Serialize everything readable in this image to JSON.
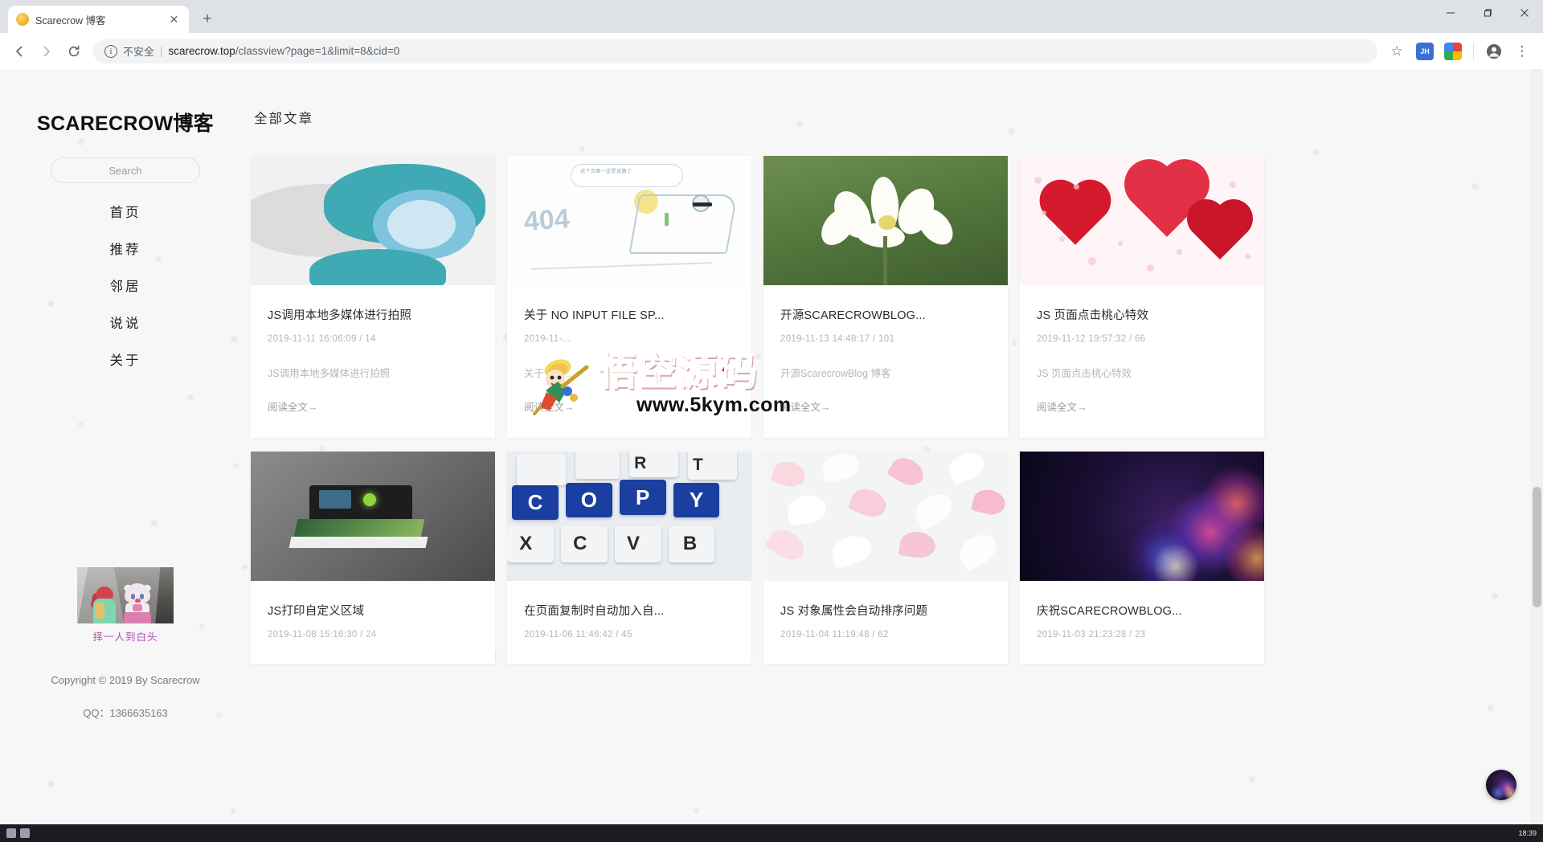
{
  "browser": {
    "tab": {
      "title": "Scarecrow 博客",
      "favicon": "cookie-icon",
      "close": "✕"
    },
    "new_tab": "+",
    "window_controls": {
      "minimize": "minimize-icon",
      "maximize": "maximize-icon",
      "close": "close-icon"
    },
    "nav": {
      "back": "←",
      "forward": "→",
      "reload": "⟳"
    },
    "omnibox": {
      "info_icon": "i",
      "security_label": "不安全",
      "separator": "|",
      "url_host": "scarecrow.top",
      "url_path": "/classview?page=1&limit=8&cid=0"
    },
    "toolbar_right": {
      "bookmark": "☆",
      "extension_1": "JH",
      "extension_2": "rainbow-extension-icon",
      "profile": "profile-icon",
      "menu": "⋮"
    }
  },
  "sidebar": {
    "brand": "SCARECROW博客",
    "search_placeholder": "Search",
    "search_value": "",
    "nav_items": [
      {
        "label": "首页"
      },
      {
        "label": "推荐"
      },
      {
        "label": "邻居"
      },
      {
        "label": "说说"
      },
      {
        "label": "关于"
      }
    ],
    "avatar_caption": "择一人到白头",
    "copyright": "Copyright © 2019 By Scarecrow",
    "qq": "QQ：1366635163"
  },
  "content": {
    "section_title": "全部文章",
    "read_more_label": "阅读全文→",
    "cards": [
      {
        "title": "JS调用本地多媒体进行拍照",
        "meta": "2019-11-11 16:06:09 / 14",
        "desc": "JS调用本地多媒体进行拍照",
        "thumb": "t1"
      },
      {
        "title": "关于 NO INPUT FILE SP...",
        "meta": "2019-11-...",
        "desc": "关于 No ...",
        "thumb": "t2"
      },
      {
        "title": "开源SCARECROWBLOG...",
        "meta": "2019-11-13 14:48:17 / 101",
        "desc": "开源ScarecrowBlog 博客",
        "thumb": "t3"
      },
      {
        "title": "JS 页面点击桃心特效",
        "meta": "2019-11-12 19:57:32 / 66",
        "desc": "JS 页面点击桃心特效",
        "thumb": "t4"
      },
      {
        "title": "JS打印自定义区域",
        "meta": "2019-11-08 15:16:30 / 24",
        "desc": "",
        "thumb": "t5"
      },
      {
        "title": "在页面复制时自动加入自...",
        "meta": "2019-11-06 11:46:42 / 45",
        "desc": "",
        "thumb": "t6"
      },
      {
        "title": "JS 对象属性会自动排序问题",
        "meta": "2019-11-04 11:19:48 / 62",
        "desc": "",
        "thumb": "t7"
      },
      {
        "title": "庆祝SCARECROWBLOG...",
        "meta": "2019-11-03 21:23:28 / 23",
        "desc": "",
        "thumb": "t8"
      }
    ]
  },
  "watermark": {
    "logo_text": "悟空源码",
    "site": "www.5kym.com",
    "color": "#e0221f"
  },
  "taskbar": {
    "time": "18:39"
  },
  "colors": {
    "page_bg": "#f7f7f7",
    "card_bg": "#ffffff",
    "brand_text": "#111111",
    "accent_purple": "#b24fb2",
    "meta_gray": "#b6b6b6"
  }
}
